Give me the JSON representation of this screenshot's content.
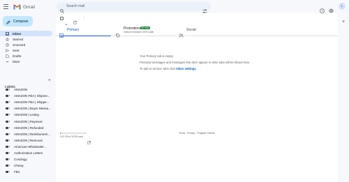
{
  "app": {
    "name": "Gmail"
  },
  "search": {
    "placeholder": "Search mail"
  },
  "account": {
    "initial": "L"
  },
  "compose": {
    "label": "Compose"
  },
  "nav": [
    {
      "label": "Inbox",
      "icon": "inbox-icon"
    },
    {
      "label": "Starred",
      "icon": "star-icon"
    },
    {
      "label": "Snoozed",
      "icon": "clock-icon"
    },
    {
      "label": "Sent",
      "icon": "send-icon"
    },
    {
      "label": "Drafts",
      "icon": "draft-icon"
    },
    {
      "label": "More",
      "icon": "chevron-down-icon"
    }
  ],
  "labels": {
    "heading": "Labels",
    "items": [
      "AMAZON",
      "AMAZON FBA | Shipme...",
      "AMAZON FBA | Shippe...",
      "AMAZON | Buyer Messa...",
      "AMAZON | Listing",
      "AMAZON | Payment",
      "AMAZON | Refunded",
      "AMAZON | Reimbursem...",
      "AMAZON | Removal",
      "American Wholesaler...",
      "Authorization Letters",
      "Cosology",
      "Chewy",
      "FBA"
    ]
  },
  "toolbar": {
    "more": "⋮"
  },
  "tabs": {
    "primary": {
      "label": "Primary"
    },
    "promotions": {
      "label": "Promotions",
      "badge": "50 new",
      "subtitle": "Gobuch Investors, 50% south"
    },
    "social": {
      "label": "Social"
    }
  },
  "empty_state": {
    "line1": "Your Primary tab is empty.",
    "line2": "Personal messages and messages that don't appear in other tabs will be shown here.",
    "line3_prefix": "To add or remove tabs click",
    "line3_link": "inbox settings."
  },
  "footer": {
    "storage_text": "0.01 GB of 15 GB used",
    "storage_fraction": 0.001,
    "policy": "Terms · Privacy · Program Policies"
  },
  "colors": {
    "accent": "#0b57d0",
    "compose_bg": "#c2e7ff",
    "active_nav": "#d3e3fd",
    "badge": "#188038"
  }
}
